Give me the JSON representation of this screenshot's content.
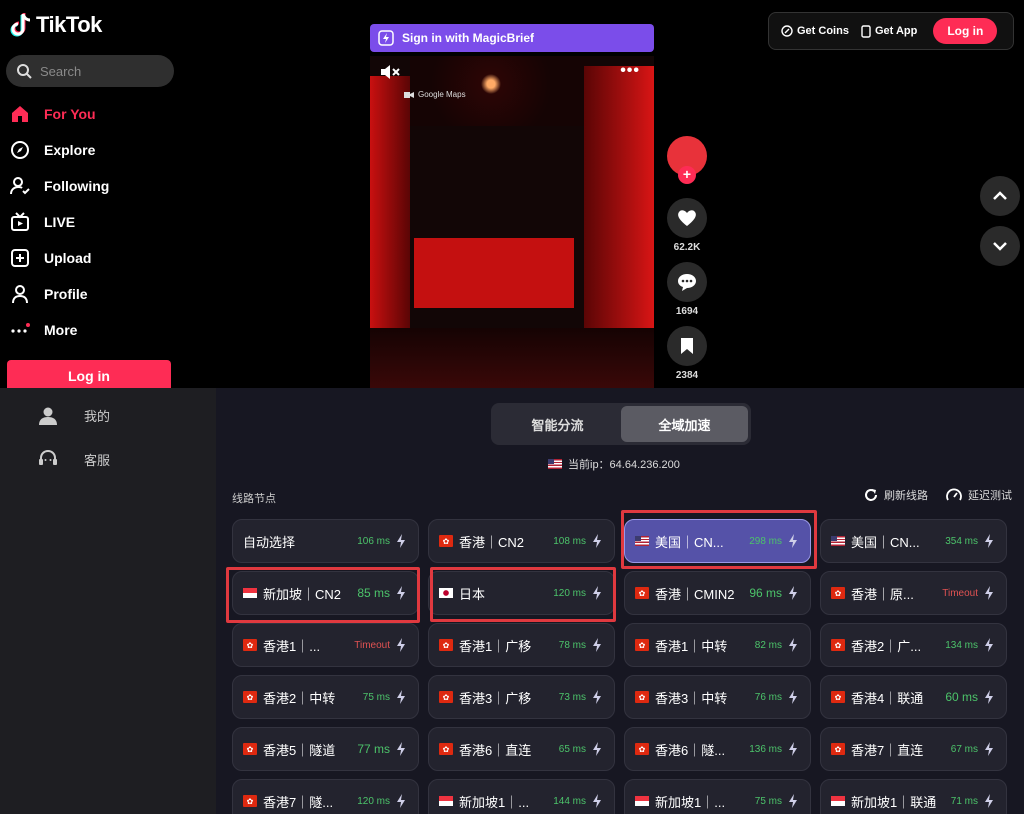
{
  "tiktok": {
    "logo_text": "TikTok",
    "search_placeholder": "Search",
    "nav": [
      {
        "label": "For You",
        "icon": "home-icon",
        "active": true
      },
      {
        "label": "Explore",
        "icon": "compass-icon",
        "active": false
      },
      {
        "label": "Following",
        "icon": "following-icon",
        "active": false
      },
      {
        "label": "LIVE",
        "icon": "live-icon",
        "active": false
      },
      {
        "label": "Upload",
        "icon": "upload-icon",
        "active": false
      },
      {
        "label": "Profile",
        "icon": "profile-icon",
        "active": false
      },
      {
        "label": "More",
        "icon": "more-icon",
        "active": false
      }
    ],
    "login_label": "Log in",
    "magicbrief_label": "Sign in with MagicBrief",
    "video_location": "Google Maps",
    "likes": "62.2K",
    "comments": "1694",
    "saves": "2384",
    "get_coins": "Get Coins",
    "get_app": "Get App",
    "top_login": "Log in",
    "accent_color": "#fe2c55"
  },
  "vpn": {
    "sidebar": [
      {
        "label": "我的",
        "icon": "user-icon"
      },
      {
        "label": "客服",
        "icon": "headset-icon"
      }
    ],
    "modes": [
      {
        "label": "智能分流",
        "active": false
      },
      {
        "label": "全域加速",
        "active": true
      }
    ],
    "current_ip_label": "当前ip：64.64.236.200",
    "section_title": "线路节点",
    "refresh_label": "刷新线路",
    "latency_test_label": "延迟测试",
    "nodes": [
      {
        "flag": "",
        "name": "自动选择",
        "ms": "106 ms",
        "status": "ok"
      },
      {
        "flag": "hk",
        "name": "香港｜CN2",
        "ms": "108 ms",
        "status": "ok"
      },
      {
        "flag": "us",
        "name": "美国｜CN...",
        "ms": "298 ms",
        "status": "ok",
        "selected": true
      },
      {
        "flag": "us",
        "name": "美国｜CN...",
        "ms": "354 ms",
        "status": "ok"
      },
      {
        "flag": "sg",
        "name": "新加坡｜CN2",
        "ms": "85 ms",
        "status": "ok",
        "big": true
      },
      {
        "flag": "jp",
        "name": "日本",
        "ms": "120 ms",
        "status": "ok"
      },
      {
        "flag": "hk",
        "name": "香港｜CMIN2",
        "ms": "96 ms",
        "status": "ok",
        "big": true
      },
      {
        "flag": "hk",
        "name": "香港｜原...",
        "ms": "Timeout",
        "status": "timeout"
      },
      {
        "flag": "hk",
        "name": "香港1｜...",
        "ms": "Timeout",
        "status": "timeout"
      },
      {
        "flag": "hk",
        "name": "香港1｜广移",
        "ms": "78 ms",
        "status": "ok"
      },
      {
        "flag": "hk",
        "name": "香港1｜中转",
        "ms": "82 ms",
        "status": "ok"
      },
      {
        "flag": "hk",
        "name": "香港2｜广...",
        "ms": "134 ms",
        "status": "ok"
      },
      {
        "flag": "hk",
        "name": "香港2｜中转",
        "ms": "75 ms",
        "status": "ok"
      },
      {
        "flag": "hk",
        "name": "香港3｜广移",
        "ms": "73 ms",
        "status": "ok"
      },
      {
        "flag": "hk",
        "name": "香港3｜中转",
        "ms": "76 ms",
        "status": "ok"
      },
      {
        "flag": "hk",
        "name": "香港4｜联通",
        "ms": "60 ms",
        "status": "ok",
        "big": true
      },
      {
        "flag": "hk",
        "name": "香港5｜隧道",
        "ms": "77 ms",
        "status": "ok",
        "big": true
      },
      {
        "flag": "hk",
        "name": "香港6｜直连",
        "ms": "65 ms",
        "status": "ok"
      },
      {
        "flag": "hk",
        "name": "香港6｜隧...",
        "ms": "136 ms",
        "status": "ok"
      },
      {
        "flag": "hk",
        "name": "香港7｜直连",
        "ms": "67 ms",
        "status": "ok"
      },
      {
        "flag": "hk",
        "name": "香港7｜隧...",
        "ms": "120 ms",
        "status": "ok"
      },
      {
        "flag": "sg",
        "name": "新加坡1｜...",
        "ms": "144 ms",
        "status": "ok"
      },
      {
        "flag": "sg",
        "name": "新加坡1｜...",
        "ms": "75 ms",
        "status": "ok"
      },
      {
        "flag": "sg",
        "name": "新加坡1｜联通",
        "ms": "71 ms",
        "status": "ok"
      }
    ],
    "highlight_color": "#e0393f",
    "latency_color": "#4cc36a"
  }
}
